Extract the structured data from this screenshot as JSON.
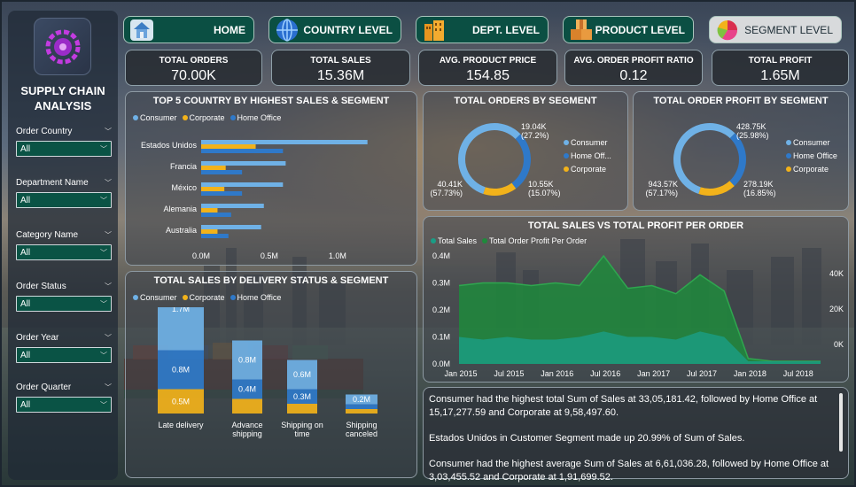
{
  "sidebar": {
    "title": "SUPPLY CHAIN ANALYSIS",
    "filters": [
      {
        "label": "Order Country",
        "value": "All"
      },
      {
        "label": "Department Name",
        "value": "All"
      },
      {
        "label": "Category Name",
        "value": "All"
      },
      {
        "label": "Order Status",
        "value": "All"
      },
      {
        "label": "Order Year",
        "value": "All"
      },
      {
        "label": "Order Quarter",
        "value": "All"
      }
    ]
  },
  "nav": [
    {
      "label": "HOME",
      "icon": "home-icon"
    },
    {
      "label": "COUNTRY LEVEL",
      "icon": "globe-icon"
    },
    {
      "label": "DEPT. LEVEL",
      "icon": "building-icon"
    },
    {
      "label": "PRODUCT LEVEL",
      "icon": "boxes-icon"
    },
    {
      "label": "SEGMENT LEVEL",
      "icon": "pie-chart-icon",
      "active": true
    }
  ],
  "kpis": [
    {
      "label": "TOTAL ORDERS",
      "value": "70.00K"
    },
    {
      "label": "TOTAL SALES",
      "value": "15.36M"
    },
    {
      "label": "AVG. PRODUCT PRICE",
      "value": "154.85"
    },
    {
      "label": "AVG. ORDER PROFIT RATIO",
      "value": "0.12"
    },
    {
      "label": "TOTAL PROFIT",
      "value": "1.65M"
    }
  ],
  "colors": {
    "consumer": "#6fb1e6",
    "corporate": "#f2b21a",
    "home_office": "#2f79c9",
    "teal": "#1a9d86",
    "green": "#1f8a3c"
  },
  "legend_segments": [
    "Consumer",
    "Corporate",
    "Home Office"
  ],
  "country_chart": {
    "title": "TOP 5 COUNTRY BY HIGHEST SALES & SEGMENT",
    "x_ticks": [
      "0.0M",
      "0.5M",
      "1.0M"
    ]
  },
  "delivery_chart": {
    "title": "TOTAL SALES BY DELIVERY STATUS & SEGMENT"
  },
  "orders_donut": {
    "title": "TOTAL ORDERS BY SEGMENT",
    "legend": [
      "Consumer",
      "Home Off...",
      "Corporate"
    ],
    "labels": [
      {
        "v": "19.04K",
        "p": "(27.2%)"
      },
      {
        "v": "10.55K",
        "p": "(15.07%)"
      },
      {
        "v": "40.41K",
        "p": "(57.73%)"
      }
    ]
  },
  "profit_donut": {
    "title": "TOTAL ORDER PROFIT BY SEGMENT",
    "legend": [
      "Consumer",
      "Home Office",
      "Corporate"
    ],
    "labels": [
      {
        "v": "428.75K",
        "p": "(25.98%)"
      },
      {
        "v": "278.19K",
        "p": "(16.85%)"
      },
      {
        "v": "943.57K",
        "p": "(57.17%)"
      }
    ]
  },
  "trend_chart": {
    "title": "TOTAL SALES VS TOTAL PROFIT PER ORDER",
    "legend": [
      "Total Sales",
      "Total Order Profit Per Order"
    ],
    "y_ticks": [
      "0.4M",
      "0.3M",
      "0.2M",
      "0.1M",
      "0.0M"
    ],
    "y2_ticks": [
      "40K",
      "20K",
      "0K"
    ],
    "x_ticks": [
      "Jan 2015",
      "Jul 2015",
      "Jan 2016",
      "Jul 2016",
      "Jan 2017",
      "Jul 2017",
      "Jan 2018",
      "Jul 2018"
    ]
  },
  "narrative": {
    "p1": "Consumer had the highest total Sum of Sales at 33,05,181.42, followed by Home Office at 15,17,277.59 and Corporate at 9,58,497.60.",
    "p2": "Estados Unidos in Customer Segment  made up 20.99% of Sum of Sales.",
    "p3": "Consumer had the highest average Sum of Sales at 6,61,036.28, followed by Home Office at 3,03,455.52 and Corporate at 1,91,699.52."
  },
  "chart_data": [
    {
      "type": "bar",
      "title": "TOP 5 COUNTRY BY HIGHEST SALES & SEGMENT",
      "categories": [
        "Estados Unidos",
        "Francia",
        "México",
        "Alemania",
        "Australia"
      ],
      "series": [
        {
          "name": "Consumer",
          "values": [
            1.22,
            0.62,
            0.6,
            0.46,
            0.44
          ]
        },
        {
          "name": "Corporate",
          "values": [
            0.4,
            0.18,
            0.17,
            0.12,
            0.12
          ]
        },
        {
          "name": "Home Office",
          "values": [
            0.6,
            0.3,
            0.3,
            0.22,
            0.2
          ]
        }
      ],
      "xlim": [
        0,
        1.3
      ],
      "xticks": [
        "0.0M",
        "0.5M",
        "1.0M"
      ]
    },
    {
      "type": "bar",
      "title": "TOTAL SALES BY DELIVERY STATUS & SEGMENT",
      "categories": [
        "Late delivery",
        "Advance shipping",
        "Shipping on time",
        "Shipping canceled"
      ],
      "series": [
        {
          "name": "Consumer",
          "values": [
            1.7,
            0.8,
            0.6,
            0.2
          ],
          "labels": [
            "1.7M",
            "0.8M",
            "0.6M",
            "0.2M"
          ]
        },
        {
          "name": "Home Office",
          "values": [
            0.8,
            0.4,
            0.3,
            0.1
          ],
          "labels": [
            "0.8M",
            "0.4M",
            "0.3M",
            ""
          ]
        },
        {
          "name": "Corporate",
          "values": [
            0.5,
            0.3,
            0.2,
            0.05
          ],
          "labels": [
            "0.5M",
            "",
            "",
            ""
          ]
        }
      ]
    },
    {
      "type": "pie",
      "title": "TOTAL ORDERS BY SEGMENT",
      "labels": [
        "Consumer",
        "Home Office",
        "Corporate"
      ],
      "values": [
        40.41,
        19.04,
        10.55
      ]
    },
    {
      "type": "pie",
      "title": "TOTAL ORDER PROFIT BY SEGMENT",
      "labels": [
        "Consumer",
        "Home Office",
        "Corporate"
      ],
      "values": [
        943.57,
        428.75,
        278.19
      ]
    },
    {
      "type": "area",
      "title": "TOTAL SALES VS TOTAL PROFIT PER ORDER",
      "x": [
        "Jan 2015",
        "Apr 2015",
        "Jul 2015",
        "Oct 2015",
        "Jan 2016",
        "Apr 2016",
        "Jul 2016",
        "Oct 2016",
        "Jan 2017",
        "Apr 2017",
        "Jul 2017",
        "Oct 2017",
        "Jan 2018",
        "Apr 2018",
        "Jul 2018",
        "Oct 2018"
      ],
      "series": [
        {
          "name": "Total Sales",
          "values": [
            0.29,
            0.3,
            0.3,
            0.29,
            0.3,
            0.29,
            0.4,
            0.28,
            0.29,
            0.26,
            0.33,
            0.27,
            0.02,
            0.01,
            0.01,
            0.01
          ]
        },
        {
          "name": "Total Order Profit Per Order",
          "values": [
            0.1,
            0.09,
            0.1,
            0.09,
            0.09,
            0.1,
            0.12,
            0.1,
            0.1,
            0.09,
            0.12,
            0.1,
            0.01,
            0.01,
            0.01,
            0.01
          ]
        }
      ],
      "ylim": [
        0,
        0.4
      ],
      "y2ticks": [
        "40K",
        "20K",
        "0K"
      ]
    }
  ]
}
